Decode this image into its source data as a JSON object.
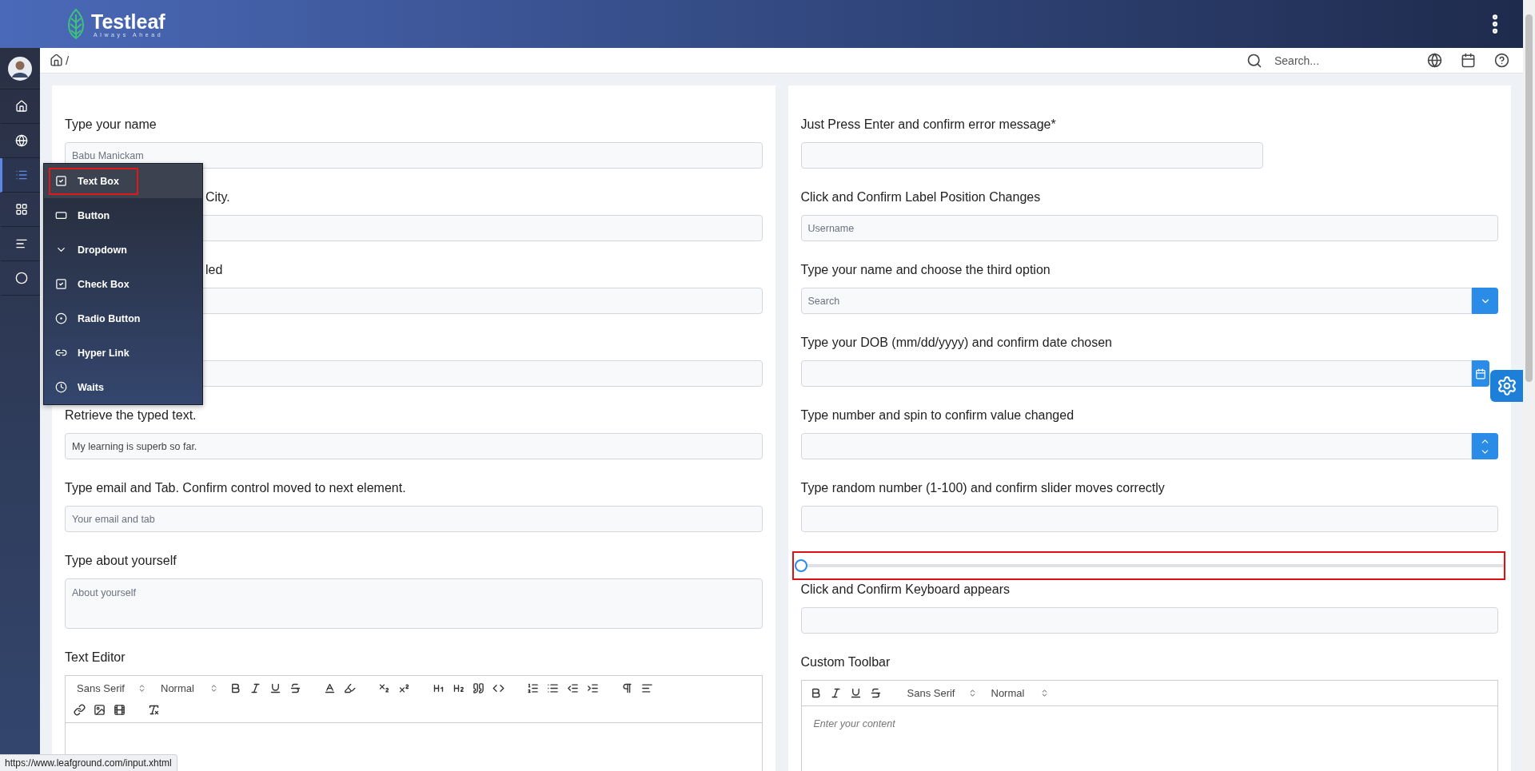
{
  "header": {
    "brand": "Testleaf",
    "tagline": "Always Ahead"
  },
  "sidebar": {
    "items": [
      {
        "kind": "home",
        "selected": false
      },
      {
        "kind": "globe",
        "selected": false
      },
      {
        "kind": "list",
        "selected": true
      },
      {
        "kind": "grid",
        "selected": false
      },
      {
        "kind": "text",
        "selected": false
      },
      {
        "kind": "circle",
        "selected": false
      }
    ]
  },
  "breadcrumb": {
    "separator": "/"
  },
  "search": {
    "placeholder": "Search..."
  },
  "menu": {
    "items": [
      {
        "label": "Text Box",
        "kind": "checkbox",
        "selected": true,
        "highlighted": true
      },
      {
        "label": "Button",
        "kind": "button",
        "selected": false,
        "highlighted": false
      },
      {
        "label": "Dropdown",
        "kind": "chevron",
        "selected": false,
        "highlighted": false
      },
      {
        "label": "Check Box",
        "kind": "checkbox",
        "selected": false,
        "highlighted": false
      },
      {
        "label": "Radio Button",
        "kind": "radio",
        "selected": false,
        "highlighted": false
      },
      {
        "label": "Hyper Link",
        "kind": "link",
        "selected": false,
        "highlighted": false
      },
      {
        "label": "Waits",
        "kind": "clock",
        "selected": false,
        "highlighted": false
      }
    ]
  },
  "left_fields": [
    {
      "kind": "input",
      "label": "Type your name",
      "placeholder": "Babu Manickam"
    },
    {
      "kind": "input",
      "label": "City.",
      "label_clipped": true
    },
    {
      "kind": "input",
      "label": "led",
      "label_clipped": true
    },
    {
      "kind": "input"
    },
    {
      "kind": "input",
      "label": "Retrieve the typed text.",
      "value": "My learning is superb so far."
    },
    {
      "kind": "input",
      "label": "Type email and Tab. Confirm control moved to next element.",
      "placeholder": "Your email and tab"
    },
    {
      "kind": "textarea",
      "label": "Type about yourself",
      "placeholder": "About yourself"
    },
    {
      "kind": "editor",
      "label": "Text Editor",
      "font": "Sans Serif",
      "size": "Normal"
    }
  ],
  "right_fields": [
    {
      "kind": "short",
      "label": "Just Press Enter and confirm error message*"
    },
    {
      "kind": "input",
      "label": "Click and Confirm Label Position Changes",
      "placeholder": "Username"
    },
    {
      "kind": "dropdown",
      "label": "Type your name and choose the third option",
      "placeholder": "Search"
    },
    {
      "kind": "date",
      "label": "Type your DOB (mm/dd/yyyy) and confirm date chosen"
    },
    {
      "kind": "spin",
      "label": "Type number and spin to confirm value changed"
    },
    {
      "kind": "input",
      "label": "Type random number (1-100) and confirm slider moves correctly"
    },
    {
      "kind": "slider",
      "level": 0,
      "highlighted": true
    },
    {
      "kind": "input",
      "label": "Click and Confirm Keyboard appears"
    },
    {
      "kind": "custom_editor",
      "label": "Custom Toolbar",
      "font": "Sans Serif",
      "size": "Normal",
      "placeholder": "Enter your content"
    }
  ],
  "status_url": "https://www.leafground.com/input.xhtml"
}
